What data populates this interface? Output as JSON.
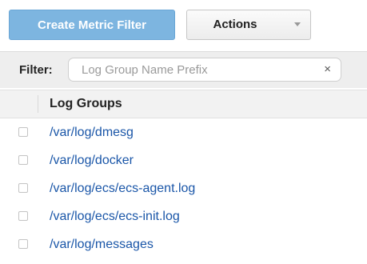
{
  "toolbar": {
    "create_label": "Create Metric Filter",
    "actions_label": "Actions"
  },
  "filter": {
    "label": "Filter:",
    "placeholder": "Log Group Name Prefix",
    "value": "",
    "clear_glyph": "×"
  },
  "table": {
    "column_title": "Log Groups",
    "rows": [
      "/var/log/dmesg",
      "/var/log/docker",
      "/var/log/ecs/ecs-agent.log",
      "/var/log/ecs/ecs-init.log",
      "/var/log/messages"
    ]
  },
  "colors": {
    "primary_button": "#7db5e0",
    "link": "#1a56a8"
  },
  "icons": {
    "actions_dropdown": "chevron-down-icon",
    "clear_filter": "close-icon"
  }
}
